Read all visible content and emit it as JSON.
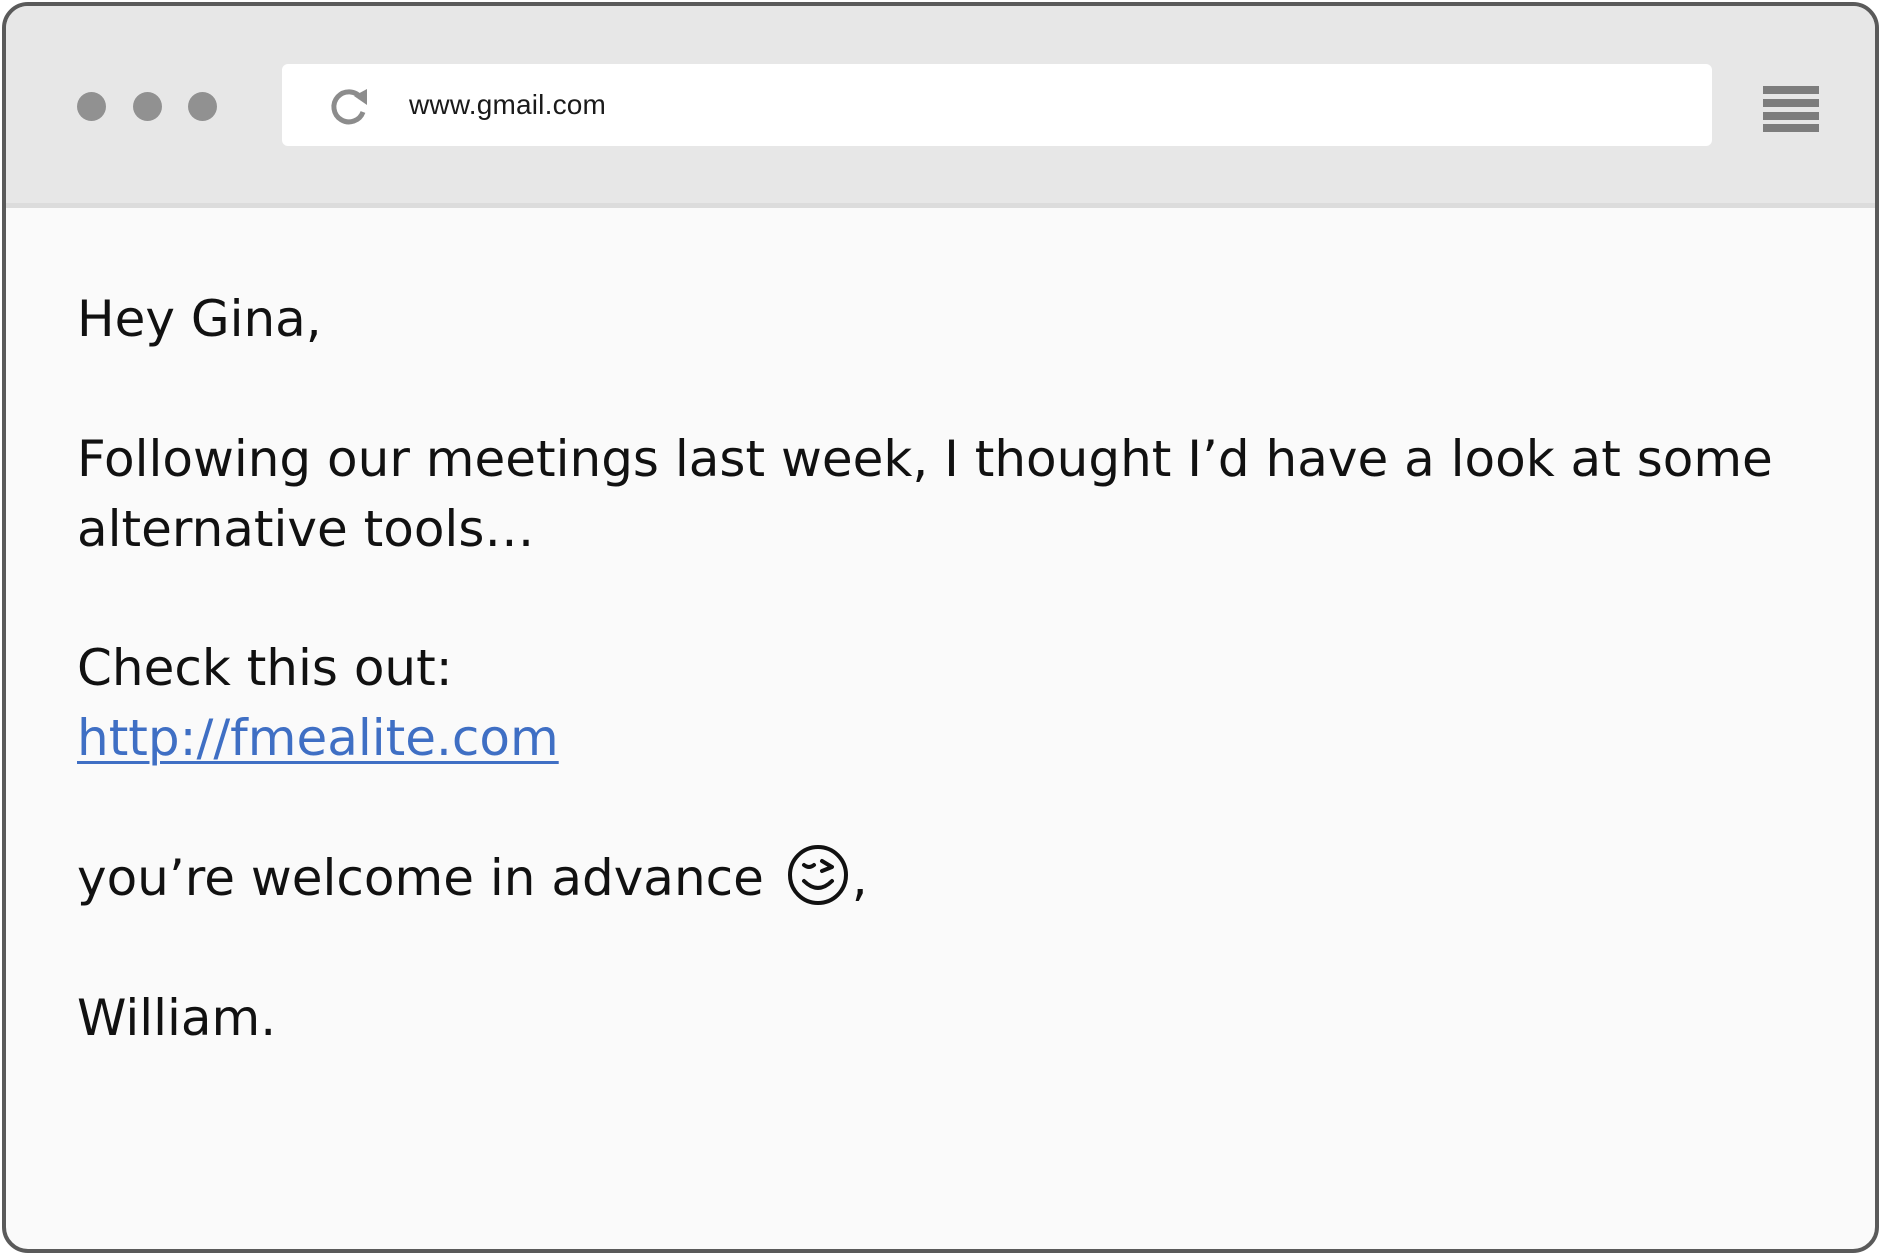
{
  "browser": {
    "url": "www.gmail.com",
    "icons": {
      "reload": "reload-icon",
      "menu": "hamburger-menu-icon",
      "window_controls": "window-dots"
    }
  },
  "email": {
    "greeting": "Hey Gina,",
    "paragraph": "Following our meetings last week, I thought I’d have a look at some alternative tools…",
    "check_line": "Check this out:",
    "link": "http://fmealite.com",
    "welcome_text": "you’re welcome in advance",
    "welcome_emoji": "winking-face-icon",
    "welcome_suffix": ",",
    "signoff": "William."
  },
  "colors": {
    "link": "#3f6fc4",
    "toolbar": "#e7e7e7",
    "page": "#fafafa",
    "frame": "#5a5a5a"
  }
}
